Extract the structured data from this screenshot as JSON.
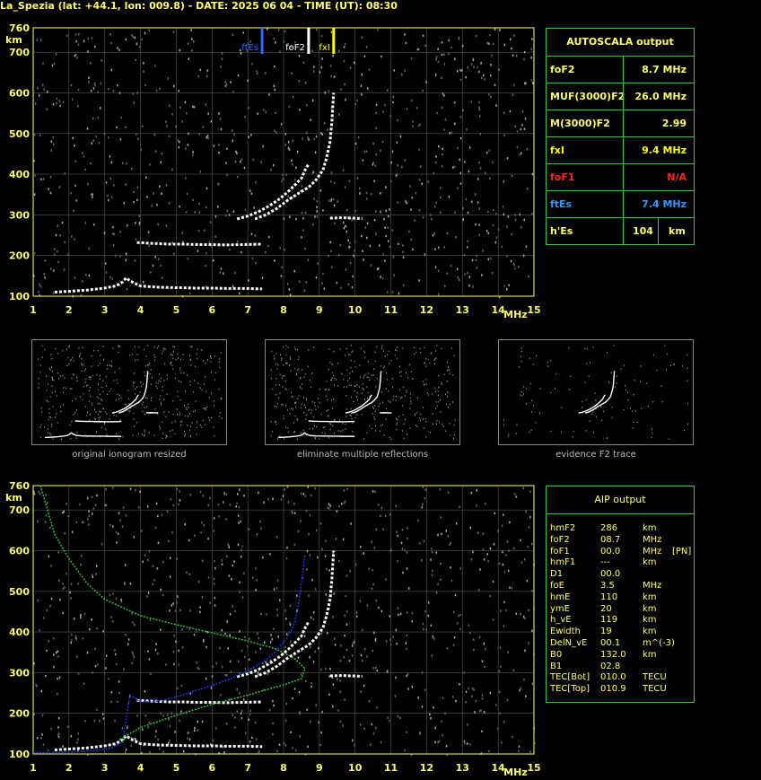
{
  "header": {
    "title": "La_Spezia (lat: +44.1, lon: 009.8) - DATE: 2025 06 04 - TIME (UT): 08:30"
  },
  "chart_data": [
    {
      "type": "scatter",
      "id": "top-ionogram",
      "xlabel": "MHz",
      "ylabel": "km",
      "xlim": [
        1,
        15
      ],
      "ylim": [
        100,
        760
      ],
      "xticks": [
        1,
        2,
        3,
        4,
        5,
        6,
        7,
        8,
        9,
        10,
        11,
        12,
        13,
        14,
        15
      ],
      "yticks": [
        100,
        200,
        300,
        400,
        500,
        600,
        700,
        760
      ],
      "grid": true,
      "markers": [
        {
          "label": "ftEs",
          "x": 7.4,
          "color": "#3366ff"
        },
        {
          "label": "foF2",
          "x": 8.7,
          "color": "#ffffff"
        },
        {
          "label": "fxI",
          "x": 9.4,
          "color": "#ffff00"
        }
      ],
      "series": [
        {
          "color": "#ffffff",
          "points": [
            [
              1.6,
              110
            ],
            [
              2.0,
              112
            ],
            [
              2.5,
              115
            ],
            [
              3.0,
              120
            ],
            [
              3.3,
              125
            ],
            [
              3.5,
              135
            ],
            [
              3.6,
              145
            ],
            [
              3.7,
              138
            ],
            [
              4.0,
              125
            ],
            [
              4.5,
              122
            ],
            [
              5.0,
              121
            ],
            [
              5.5,
              120
            ],
            [
              6.0,
              120
            ],
            [
              6.5,
              119
            ],
            [
              7.0,
              119
            ],
            [
              7.4,
              118
            ]
          ]
        },
        {
          "color": "#ffffff",
          "points": [
            [
              3.9,
              232
            ],
            [
              4.3,
              230
            ],
            [
              4.8,
              228
            ],
            [
              5.2,
              228
            ],
            [
              5.6,
              227
            ],
            [
              6.0,
              227
            ],
            [
              6.4,
              226
            ],
            [
              7.4,
              228
            ]
          ]
        },
        {
          "color": "#ffffff",
          "points": [
            [
              6.7,
              290
            ],
            [
              7.0,
              297
            ],
            [
              7.3,
              308
            ],
            [
              7.6,
              322
            ],
            [
              7.9,
              340
            ],
            [
              8.1,
              355
            ],
            [
              8.3,
              372
            ],
            [
              8.5,
              390
            ],
            [
              8.6,
              410
            ],
            [
              8.7,
              425
            ]
          ]
        },
        {
          "color": "#ffffff",
          "points": [
            [
              7.2,
              290
            ],
            [
              7.5,
              300
            ],
            [
              7.8,
              315
            ],
            [
              8.1,
              335
            ],
            [
              8.4,
              352
            ],
            [
              8.7,
              368
            ],
            [
              8.9,
              385
            ],
            [
              9.1,
              410
            ],
            [
              9.2,
              440
            ],
            [
              9.3,
              480
            ],
            [
              9.35,
              530
            ],
            [
              9.4,
              600
            ]
          ]
        },
        {
          "color": "#ffffff",
          "points": [
            [
              9.3,
              292
            ],
            [
              9.6,
              293
            ],
            [
              9.9,
              292
            ],
            [
              10.2,
              291
            ]
          ]
        }
      ]
    },
    {
      "type": "scatter",
      "id": "bottom-ionogram",
      "xlabel": "MHz",
      "ylabel": "km",
      "xlim": [
        1,
        15
      ],
      "ylim": [
        100,
        760
      ],
      "xticks": [
        1,
        2,
        3,
        4,
        5,
        6,
        7,
        8,
        9,
        10,
        11,
        12,
        13,
        14,
        15
      ],
      "yticks": [
        100,
        200,
        300,
        400,
        500,
        600,
        700,
        760
      ],
      "grid": true,
      "series": [
        {
          "color": "#ffffff",
          "points": [
            [
              1.6,
              110
            ],
            [
              2.0,
              112
            ],
            [
              2.5,
              115
            ],
            [
              3.0,
              120
            ],
            [
              3.3,
              125
            ],
            [
              3.5,
              135
            ],
            [
              3.6,
              145
            ],
            [
              3.7,
              138
            ],
            [
              4.0,
              125
            ],
            [
              4.5,
              122
            ],
            [
              5.0,
              121
            ],
            [
              5.5,
              120
            ],
            [
              6.0,
              120
            ],
            [
              6.5,
              119
            ],
            [
              7.0,
              119
            ],
            [
              7.4,
              118
            ]
          ]
        },
        {
          "color": "#ffffff",
          "points": [
            [
              3.9,
              232
            ],
            [
              4.3,
              230
            ],
            [
              4.8,
              228
            ],
            [
              5.2,
              228
            ],
            [
              5.6,
              227
            ],
            [
              6.0,
              227
            ],
            [
              6.4,
              226
            ],
            [
              7.4,
              228
            ]
          ]
        },
        {
          "color": "#ffffff",
          "points": [
            [
              6.7,
              290
            ],
            [
              7.0,
              297
            ],
            [
              7.3,
              308
            ],
            [
              7.6,
              322
            ],
            [
              7.9,
              340
            ],
            [
              8.1,
              355
            ],
            [
              8.3,
              372
            ],
            [
              8.5,
              390
            ],
            [
              8.6,
              410
            ],
            [
              8.7,
              425
            ]
          ]
        },
        {
          "color": "#ffffff",
          "points": [
            [
              7.2,
              290
            ],
            [
              7.5,
              300
            ],
            [
              7.8,
              315
            ],
            [
              8.1,
              335
            ],
            [
              8.4,
              352
            ],
            [
              8.7,
              368
            ],
            [
              8.9,
              385
            ],
            [
              9.1,
              410
            ],
            [
              9.2,
              440
            ],
            [
              9.3,
              480
            ],
            [
              9.35,
              530
            ],
            [
              9.4,
              600
            ]
          ]
        },
        {
          "color": "#ffffff",
          "points": [
            [
              9.3,
              292
            ],
            [
              9.6,
              293
            ],
            [
              9.9,
              292
            ],
            [
              10.2,
              291
            ]
          ]
        },
        {
          "color": "#2233ff",
          "points": [
            [
              1.0,
              103
            ],
            [
              2.0,
              104
            ],
            [
              2.7,
              108
            ],
            [
              3.2,
              115
            ],
            [
              3.5,
              130
            ],
            [
              3.7,
              245
            ],
            [
              4.0,
              228
            ],
            [
              4.5,
              230
            ],
            [
              5.0,
              240
            ],
            [
              5.5,
              255
            ],
            [
              6.0,
              268
            ],
            [
              6.5,
              285
            ],
            [
              7.0,
              305
            ],
            [
              7.5,
              330
            ],
            [
              7.8,
              355
            ],
            [
              8.1,
              385
            ],
            [
              8.3,
              420
            ],
            [
              8.4,
              460
            ],
            [
              8.5,
              520
            ],
            [
              8.6,
              590
            ]
          ]
        },
        {
          "color": "#33cc33",
          "points": [
            [
              1.2,
              760
            ],
            [
              1.6,
              640
            ],
            [
              2.0,
              580
            ],
            [
              2.5,
              520
            ],
            [
              3.0,
              480
            ],
            [
              4.0,
              440
            ],
            [
              5.0,
              418
            ],
            [
              6.0,
              398
            ],
            [
              7.0,
              378
            ],
            [
              7.8,
              358
            ],
            [
              8.3,
              335
            ],
            [
              8.6,
              310
            ],
            [
              8.5,
              285
            ],
            [
              8.0,
              270
            ],
            [
              7.0,
              245
            ],
            [
              6.0,
              222
            ],
            [
              5.0,
              195
            ],
            [
              4.0,
              165
            ],
            [
              3.6,
              145
            ],
            [
              3.5,
              130
            ],
            [
              3.4,
              138
            ],
            [
              3.6,
              135
            ]
          ]
        }
      ]
    }
  ],
  "autoscala": {
    "title": "AUTOSCALA output",
    "rows": [
      {
        "label": "foF2",
        "value": "8.7 MHz",
        "label_color": "#ffff66",
        "value_color": "#ffff66"
      },
      {
        "label": "MUF(3000)F2",
        "value": "26.0 MHz",
        "label_color": "#ffff66",
        "value_color": "#ffff66"
      },
      {
        "label": "M(3000)F2",
        "value": "2.99",
        "label_color": "#ffff66",
        "value_color": "#ffff66"
      },
      {
        "label": "fxI",
        "value": "9.4 MHz",
        "label_color": "#ffff00",
        "value_color": "#ffff00"
      },
      {
        "label": "foF1",
        "value": "N/A",
        "label_color": "#ff2222",
        "value_color": "#ff2222"
      },
      {
        "label": "ftEs",
        "value": "7.4 MHz",
        "label_color": "#3399ff",
        "value_color": "#3399ff"
      },
      {
        "label": "h'Es",
        "value": "104",
        "unit": "km",
        "label_color": "#ffff66",
        "value_color": "#ffff66"
      }
    ]
  },
  "thumbnails": [
    {
      "caption": "original ionogram resized"
    },
    {
      "caption": "eliminate multiple reflections"
    },
    {
      "caption": "evidence F2 trace"
    }
  ],
  "aip": {
    "title": "AIP output",
    "rows": [
      [
        "hmF2",
        "286",
        "km",
        ""
      ],
      [
        "foF2",
        "08.7",
        "MHz",
        ""
      ],
      [
        "foF1",
        "00.0",
        "MHz",
        "[PN]"
      ],
      [
        "hmF1",
        "---",
        "km",
        ""
      ],
      [
        "D1",
        "00.0",
        "",
        ""
      ],
      [
        "foE",
        "3.5",
        "MHz",
        ""
      ],
      [
        "hmE",
        "110",
        "km",
        ""
      ],
      [
        "ymE",
        "20",
        "km",
        ""
      ],
      [
        "h_vE",
        "119",
        "km",
        ""
      ],
      [
        "Ewidth",
        "19",
        "km",
        ""
      ],
      [
        "DelN_vE",
        "00.1",
        "m^(-3)",
        ""
      ],
      [
        "B0",
        "132.0",
        "km",
        ""
      ],
      [
        "B1",
        "02.8",
        "",
        ""
      ],
      [
        "TEC[Bot]",
        "010.0",
        "TECU",
        ""
      ],
      [
        "TEC[Top]",
        "010.9",
        "TECU",
        ""
      ]
    ]
  }
}
